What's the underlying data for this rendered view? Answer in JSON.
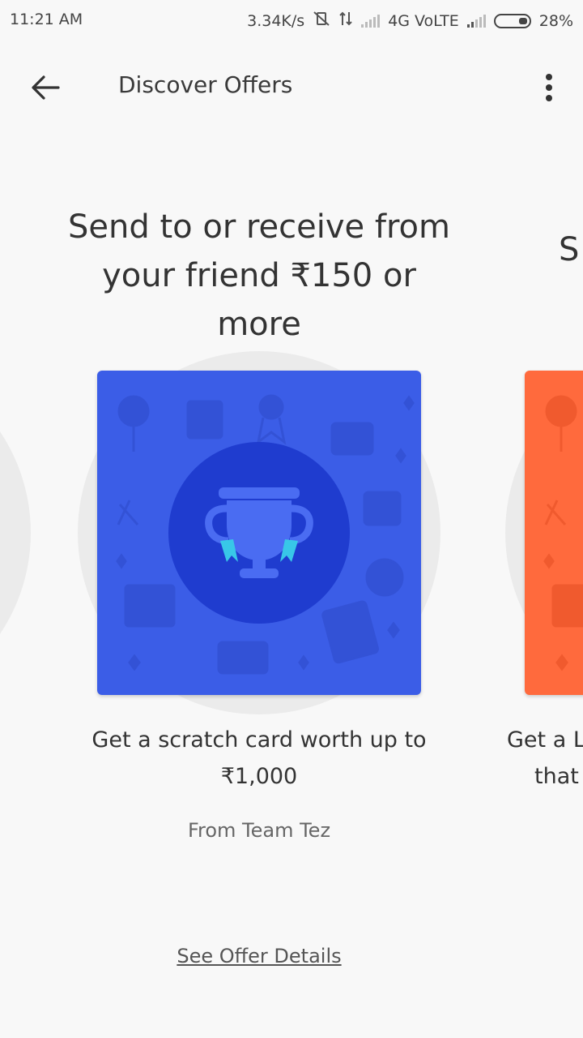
{
  "status": {
    "time": "11:21 AM",
    "speed": "3.34K/s",
    "network": "4G VoLTE",
    "battery": "28%"
  },
  "header": {
    "title": "Discover Offers"
  },
  "offer": {
    "title": "Send to or receive from your friend ₹150 or more",
    "description": "Get a scratch card worth up to ₹1,000",
    "source": "From Team Tez",
    "details_link": "See Offer Details",
    "card_color": "#3b5de7",
    "icon": "trophy-icon"
  },
  "next_offer": {
    "title_partial": "S",
    "desc_line1": "Get a L",
    "desc_line2": "that",
    "card_color": "#ff6a3d"
  }
}
